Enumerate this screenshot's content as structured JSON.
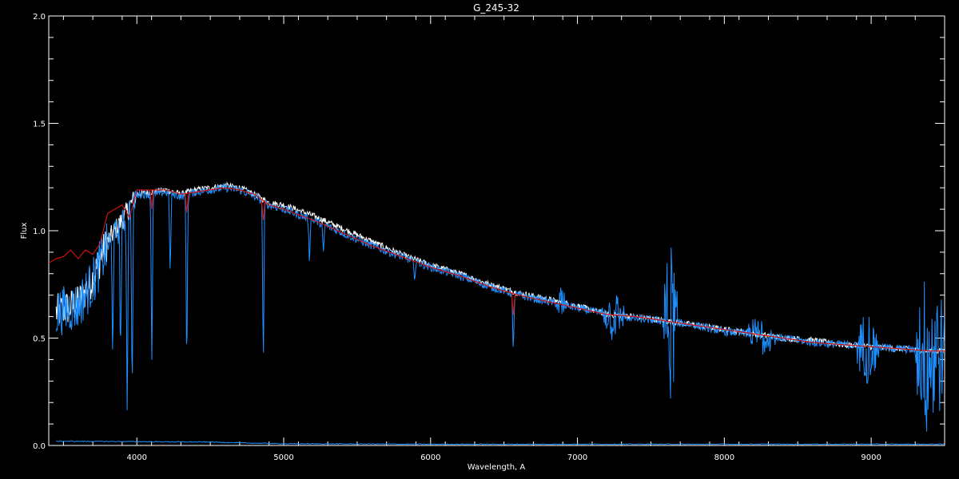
{
  "chart_data": {
    "type": "line",
    "title": "G_245-32",
    "xlabel": "Wavelength, A",
    "ylabel": "Flux",
    "xlim": [
      3400,
      9500
    ],
    "ylim": [
      0.0,
      2.0
    ],
    "x_ticks": [
      {
        "value": 4000,
        "label": "4000"
      },
      {
        "value": 5000,
        "label": "5000"
      },
      {
        "value": 6000,
        "label": "6000"
      },
      {
        "value": 7000,
        "label": "7000"
      },
      {
        "value": 8000,
        "label": "8000"
      },
      {
        "value": 9000,
        "label": "9000"
      }
    ],
    "y_ticks": [
      {
        "value": 0.0,
        "label": "0.0"
      },
      {
        "value": 0.5,
        "label": "0.5"
      },
      {
        "value": 1.0,
        "label": "1.0"
      },
      {
        "value": 1.5,
        "label": "1.5"
      },
      {
        "value": 2.0,
        "label": "2.0"
      }
    ],
    "background_color": "#000000",
    "axis_color": "#ffffff",
    "series": [
      {
        "color": "#ffffff",
        "x": [
          3450,
          3600,
          3700,
          3800,
          3900,
          4000,
          4100,
          4200,
          4300,
          4400,
          4500,
          4600,
          4700,
          4800,
          4900,
          5000,
          5200,
          5400,
          5600,
          5800,
          6000,
          6200,
          6400,
          6600,
          6800,
          7000,
          7200,
          7400,
          7600,
          7800,
          8000,
          8200,
          8400,
          8600,
          8800,
          9000,
          9200,
          9400,
          9500
        ],
        "y": [
          0.62,
          0.66,
          0.78,
          0.95,
          1.05,
          1.17,
          1.18,
          1.19,
          1.17,
          1.19,
          1.2,
          1.21,
          1.2,
          1.17,
          1.13,
          1.12,
          1.07,
          1.01,
          0.95,
          0.89,
          0.84,
          0.8,
          0.75,
          0.71,
          0.68,
          0.65,
          0.61,
          0.6,
          0.58,
          0.56,
          0.54,
          0.52,
          0.5,
          0.49,
          0.47,
          0.46,
          0.45,
          0.44,
          0.44
        ]
      },
      {
        "color": "#1e90ff",
        "x": [
          3450,
          3600,
          3700,
          3800,
          3900,
          4000,
          4100,
          4200,
          4300,
          4400,
          4500,
          4600,
          4700,
          4800,
          4900,
          5000,
          5200,
          5400,
          5600,
          5800,
          6000,
          6200,
          6400,
          6600,
          6800,
          7000,
          7200,
          7400,
          7600,
          7800,
          8000,
          8200,
          8400,
          8600,
          8800,
          9000,
          9200,
          9400,
          9500
        ],
        "y": [
          0.62,
          0.65,
          0.76,
          0.93,
          1.03,
          1.17,
          1.17,
          1.18,
          1.16,
          1.18,
          1.19,
          1.2,
          1.19,
          1.16,
          1.12,
          1.1,
          1.05,
          0.99,
          0.93,
          0.88,
          0.83,
          0.79,
          0.74,
          0.7,
          0.67,
          0.64,
          0.61,
          0.59,
          0.58,
          0.56,
          0.53,
          0.52,
          0.5,
          0.48,
          0.47,
          0.46,
          0.45,
          0.44,
          0.44
        ]
      },
      {
        "color": "#cc1111",
        "x": [
          3400,
          3450,
          3500,
          3550,
          3600,
          3650,
          3700,
          3750,
          3800,
          3850,
          3900,
          3950,
          4000,
          4100,
          4200,
          4300,
          4400,
          4500,
          4600,
          4700,
          4800,
          4900,
          5000,
          5200,
          5400,
          5600,
          5800,
          6000,
          6200,
          6400,
          6600,
          6800,
          7000,
          7200,
          7400,
          7600,
          7800,
          8000,
          8200,
          8400,
          8600,
          8800,
          9000,
          9200,
          9400,
          9500
        ],
        "y": [
          0.85,
          0.87,
          0.88,
          0.91,
          0.87,
          0.91,
          0.89,
          0.94,
          1.08,
          1.1,
          1.12,
          1.06,
          1.19,
          1.19,
          1.19,
          1.17,
          1.18,
          1.19,
          1.2,
          1.19,
          1.17,
          1.12,
          1.1,
          1.05,
          0.99,
          0.93,
          0.88,
          0.83,
          0.79,
          0.74,
          0.7,
          0.67,
          0.64,
          0.61,
          0.6,
          0.58,
          0.56,
          0.54,
          0.52,
          0.5,
          0.48,
          0.47,
          0.46,
          0.45,
          0.44,
          0.44
        ]
      },
      {
        "color": "#1e90ff",
        "x": [
          3450,
          4000,
          4500,
          4700,
          5000,
          6000,
          7000,
          8000,
          9000,
          9500
        ],
        "y": [
          0.02,
          0.018,
          0.016,
          0.012,
          0.008,
          0.006,
          0.006,
          0.006,
          0.006,
          0.006
        ]
      }
    ],
    "absorption_lines": [
      {
        "x": 3835,
        "depth": 0.55
      },
      {
        "x": 3889,
        "depth": 0.6
      },
      {
        "x": 3934,
        "depth": 0.9
      },
      {
        "x": 3968,
        "depth": 0.85
      },
      {
        "x": 4102,
        "depth": 0.72
      },
      {
        "x": 4227,
        "depth": 0.35
      },
      {
        "x": 4340,
        "depth": 0.72
      },
      {
        "x": 4861,
        "depth": 0.7
      },
      {
        "x": 5175,
        "depth": 0.2
      },
      {
        "x": 5270,
        "depth": 0.15
      },
      {
        "x": 5890,
        "depth": 0.12
      },
      {
        "x": 6563,
        "depth": 0.42
      },
      {
        "x": 6870,
        "depth": 0.08
      }
    ],
    "noisy_features": [
      {
        "x_from": 6860,
        "x_to": 6920,
        "amplitude": 0.06
      },
      {
        "x_from": 7160,
        "x_to": 7320,
        "amplitude": 0.08
      },
      {
        "x_from": 7580,
        "x_to": 7680,
        "amplitude": 0.26
      },
      {
        "x_from": 8150,
        "x_to": 8350,
        "amplitude": 0.06
      },
      {
        "x_from": 8900,
        "x_to": 9050,
        "amplitude": 0.12
      },
      {
        "x_from": 9300,
        "x_to": 9500,
        "amplitude": 0.3
      }
    ]
  }
}
